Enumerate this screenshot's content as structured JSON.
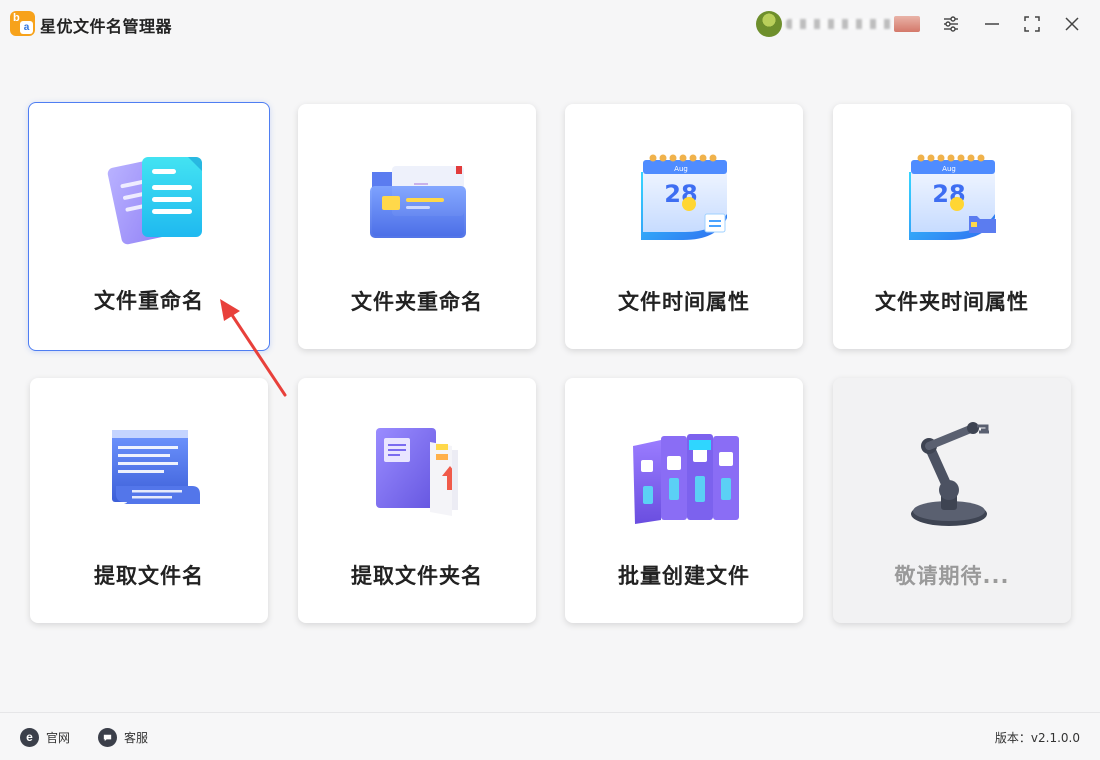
{
  "app": {
    "title": "星优文件名管理器",
    "logo_letters": [
      "b",
      "a"
    ]
  },
  "window_controls": [
    "settings-icon",
    "minimize-icon",
    "maximize-icon",
    "close-icon"
  ],
  "tiles": [
    {
      "label": "文件重命名",
      "icon": "documents-icon",
      "selected": true
    },
    {
      "label": "文件夹重命名",
      "icon": "folder-icon"
    },
    {
      "label": "文件时间属性",
      "icon": "calendar-icon",
      "calendar_month": "Aug",
      "calendar_day": "28"
    },
    {
      "label": "文件夹时间属性",
      "icon": "calendar-folder-icon",
      "calendar_month": "Aug",
      "calendar_day": "28"
    },
    {
      "label": "提取文件名",
      "icon": "scroll-document-icon"
    },
    {
      "label": "提取文件夹名",
      "icon": "book-folder-icon"
    },
    {
      "label": "批量创建文件",
      "icon": "binders-icon"
    },
    {
      "label": "敬请期待...",
      "icon": "robot-arm-icon",
      "disabled": true
    }
  ],
  "footer": {
    "website": "官网",
    "support": "客服",
    "version": "版本：v2.1.0.0"
  },
  "colors": {
    "selected_border": "#4f7ef2",
    "arrow": "#e8403b",
    "logo": "#f7a21b"
  }
}
